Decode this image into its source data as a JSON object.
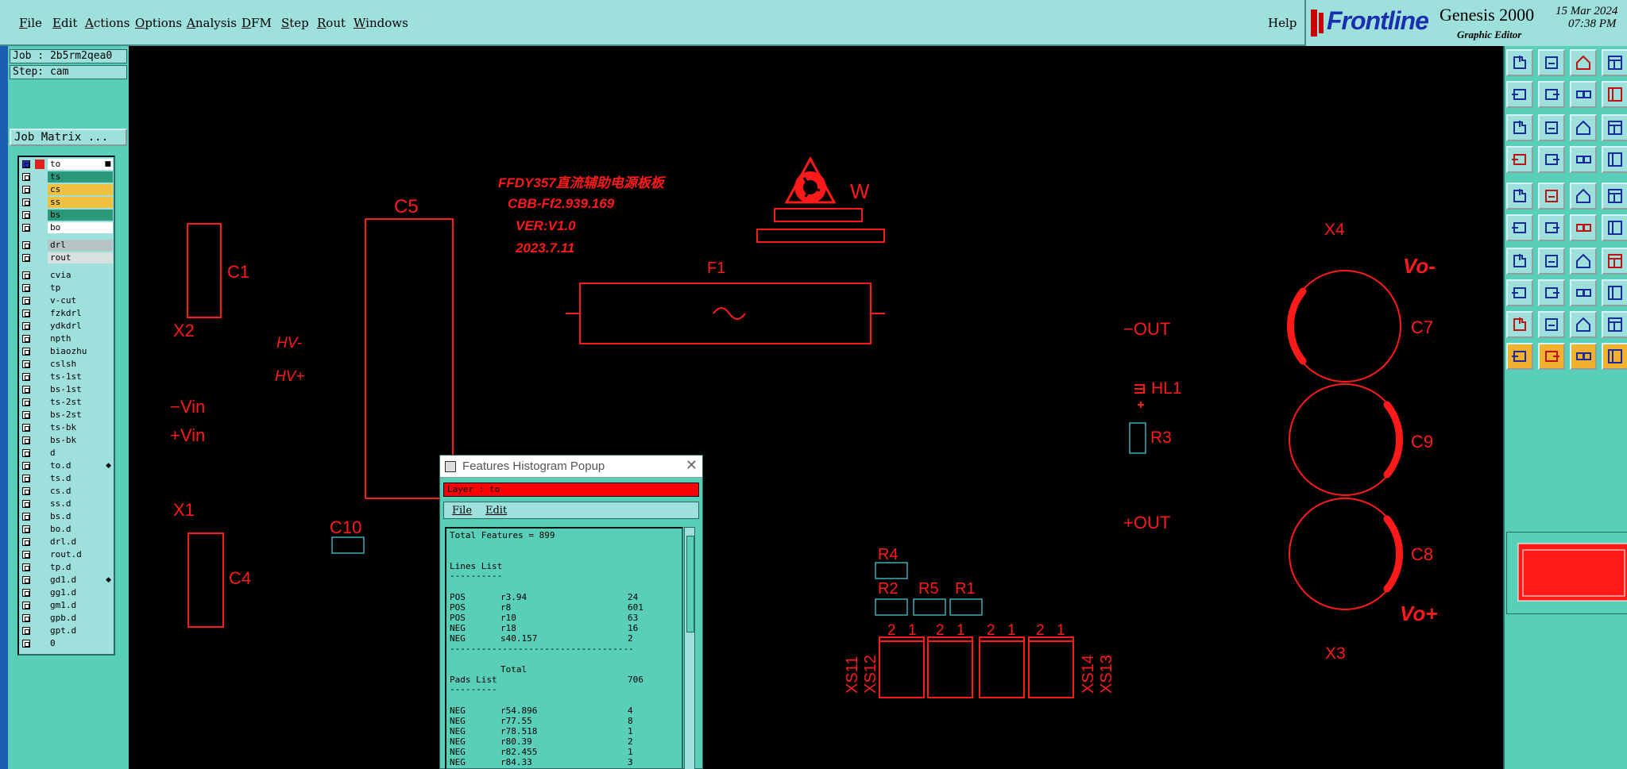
{
  "menubar": {
    "items": [
      {
        "label": "File",
        "ul": "F"
      },
      {
        "label": "Edit",
        "ul": "E"
      },
      {
        "label": "Actions",
        "ul": "A"
      },
      {
        "label": "Options",
        "ul": "O"
      },
      {
        "label": "Analysis",
        "ul": "A"
      },
      {
        "label": "DFM",
        "ul": "D"
      },
      {
        "label": "Step",
        "ul": "S"
      },
      {
        "label": "Rout",
        "ul": "R"
      },
      {
        "label": "Windows",
        "ul": "W"
      }
    ],
    "help": "Help"
  },
  "brand": {
    "name": "Frontline",
    "product": "Genesis 2000",
    "subtitle": "Graphic Editor",
    "date": "15 Mar 2024",
    "time": "07:38 PM"
  },
  "job": {
    "job_label": "Job : 2b5rm2qea0",
    "step_label": "Step: cam",
    "matrix_button": "Job Matrix ..."
  },
  "layers": [
    {
      "name": "to",
      "color": "#ffffff",
      "flag": "■"
    },
    {
      "name": "ts",
      "color": "#2a9a7a"
    },
    {
      "name": "cs",
      "color": "#f0c040"
    },
    {
      "name": "ss",
      "color": "#f0c040"
    },
    {
      "name": "bs",
      "color": "#2a9a7a"
    },
    {
      "name": "bo",
      "color": "#ffffff"
    },
    {
      "name": "drl",
      "color": "#b8c4c4"
    },
    {
      "name": "rout",
      "color": "#d8e0e0"
    },
    {
      "name": "cvia",
      "color": "#9ee0dc"
    },
    {
      "name": "tp",
      "color": "#9ee0dc"
    },
    {
      "name": "v-cut",
      "color": "#9ee0dc"
    },
    {
      "name": "fzkdrl",
      "color": "#9ee0dc"
    },
    {
      "name": "ydkdrl",
      "color": "#9ee0dc"
    },
    {
      "name": "npth",
      "color": "#9ee0dc"
    },
    {
      "name": "biaozhu",
      "color": "#9ee0dc"
    },
    {
      "name": "cslsh",
      "color": "#9ee0dc"
    },
    {
      "name": "ts-1st",
      "color": "#9ee0dc"
    },
    {
      "name": "bs-1st",
      "color": "#9ee0dc"
    },
    {
      "name": "ts-2st",
      "color": "#9ee0dc"
    },
    {
      "name": "bs-2st",
      "color": "#9ee0dc"
    },
    {
      "name": "ts-bk",
      "color": "#9ee0dc"
    },
    {
      "name": "bs-bk",
      "color": "#9ee0dc"
    },
    {
      "name": "d",
      "color": "#9ee0dc"
    },
    {
      "name": "to.d",
      "color": "#9ee0dc",
      "flag": "◆"
    },
    {
      "name": "ts.d",
      "color": "#9ee0dc"
    },
    {
      "name": "cs.d",
      "color": "#9ee0dc"
    },
    {
      "name": "ss.d",
      "color": "#9ee0dc"
    },
    {
      "name": "bs.d",
      "color": "#9ee0dc"
    },
    {
      "name": "bo.d",
      "color": "#9ee0dc"
    },
    {
      "name": "drl.d",
      "color": "#9ee0dc"
    },
    {
      "name": "rout.d",
      "color": "#9ee0dc"
    },
    {
      "name": "tp.d",
      "color": "#9ee0dc"
    },
    {
      "name": "gd1.d",
      "color": "#9ee0dc",
      "flag": "◆"
    },
    {
      "name": "gg1.d",
      "color": "#9ee0dc"
    },
    {
      "name": "gm1.d",
      "color": "#9ee0dc"
    },
    {
      "name": "gpb.d",
      "color": "#9ee0dc"
    },
    {
      "name": "gpt.d",
      "color": "#9ee0dc"
    },
    {
      "name": "0",
      "color": "#9ee0dc"
    }
  ],
  "board": {
    "title_lines": [
      "FFDY357直流辅助电源板板",
      "CBB-Ff2.939.169",
      "VER:V1.0",
      "2023.7.11"
    ],
    "labels": {
      "c1": "C1",
      "x2": "X2",
      "c5": "C5",
      "hvm": "HV-",
      "hvp": "HV+",
      "vinm": "−Vin",
      "vinp": "+Vin",
      "x1": "X1",
      "c4": "C4",
      "c10": "C10",
      "w": "W",
      "f1": "F1",
      "out_minus": "−OUT",
      "out_plus": "+OUT",
      "hl1": "HL1",
      "r3": "R3",
      "x4": "X4",
      "vo_minus": "Vo-",
      "c7": "C7",
      "c9": "C9",
      "c8": "C8",
      "vo_plus": "Vo+",
      "x3": "X3",
      "r4": "R4",
      "r2": "R2",
      "r5": "R5",
      "r1": "R1",
      "xs11": "XS11",
      "xs12": "XS12",
      "xs14": "XS14",
      "xs13": "XS13",
      "pin_a": "2",
      "pin_b": "1"
    }
  },
  "colors": {
    "silk": "#ff1a1a",
    "pad": "#3ab0b8",
    "menu_bg": "#9ee0dc",
    "panel_bg": "#5acfb8"
  },
  "popup": {
    "title": "Features Histogram Popup",
    "close": "✕",
    "layer": "Layer :  to",
    "menu": [
      "File",
      "Edit"
    ],
    "total": "Total Features = 899",
    "lines_header": "Lines List",
    "underline": "----------",
    "lines": [
      {
        "pol": "POS",
        "sym": "r3.94",
        "count": "24"
      },
      {
        "pol": "POS",
        "sym": "r8",
        "count": "601"
      },
      {
        "pol": "POS",
        "sym": "r10",
        "count": "63"
      },
      {
        "pol": "NEG",
        "sym": "r18",
        "count": "16"
      },
      {
        "pol": "NEG",
        "sym": "s40.157",
        "count": "2"
      }
    ],
    "separator": "-----------------------------------",
    "total_label": "Total",
    "lines_total": "706",
    "pads_header": "Pads List",
    "pads_underline": "---------",
    "pads": [
      {
        "pol": "NEG",
        "sym": "r54.896",
        "count": "4"
      },
      {
        "pol": "NEG",
        "sym": "r77.55",
        "count": "8"
      },
      {
        "pol": "NEG",
        "sym": "r78.518",
        "count": "1"
      },
      {
        "pol": "NEG",
        "sym": "r80.39",
        "count": "2"
      },
      {
        "pol": "NEG",
        "sym": "r82.455",
        "count": "1"
      },
      {
        "pol": "NEG",
        "sym": "r84.33",
        "count": "3"
      }
    ]
  },
  "toolbar": {
    "icons": [
      "open-job-icon",
      "save-icon",
      "home-icon",
      "window-icon",
      "import-icon",
      "export-icon",
      "swap-icon",
      "panel-icon",
      "zoom-fit-icon",
      "zoom-in-icon",
      "scale-1-2-icon",
      "help-icon",
      "measure-icon",
      "grid-icon",
      "snap-icon",
      "snap-alt-icon",
      "pad-icon",
      "line-draw-icon",
      "dash-icon",
      "circle-icon",
      "connect-icon",
      "cross-icon",
      "arc-icon",
      "route-icon",
      "slope-icon",
      "diag-icon",
      "rotate-icon",
      "flip-icon",
      "node-icon",
      "hline-icon",
      "box-icon",
      "cluster-icon",
      "surface-icon",
      "outline-icon",
      "polygon-icon",
      "polygon-alt-icon",
      "pointer-icon",
      "pointer-box-icon",
      "pointer-circle-icon",
      "pointer-multi-icon"
    ]
  }
}
